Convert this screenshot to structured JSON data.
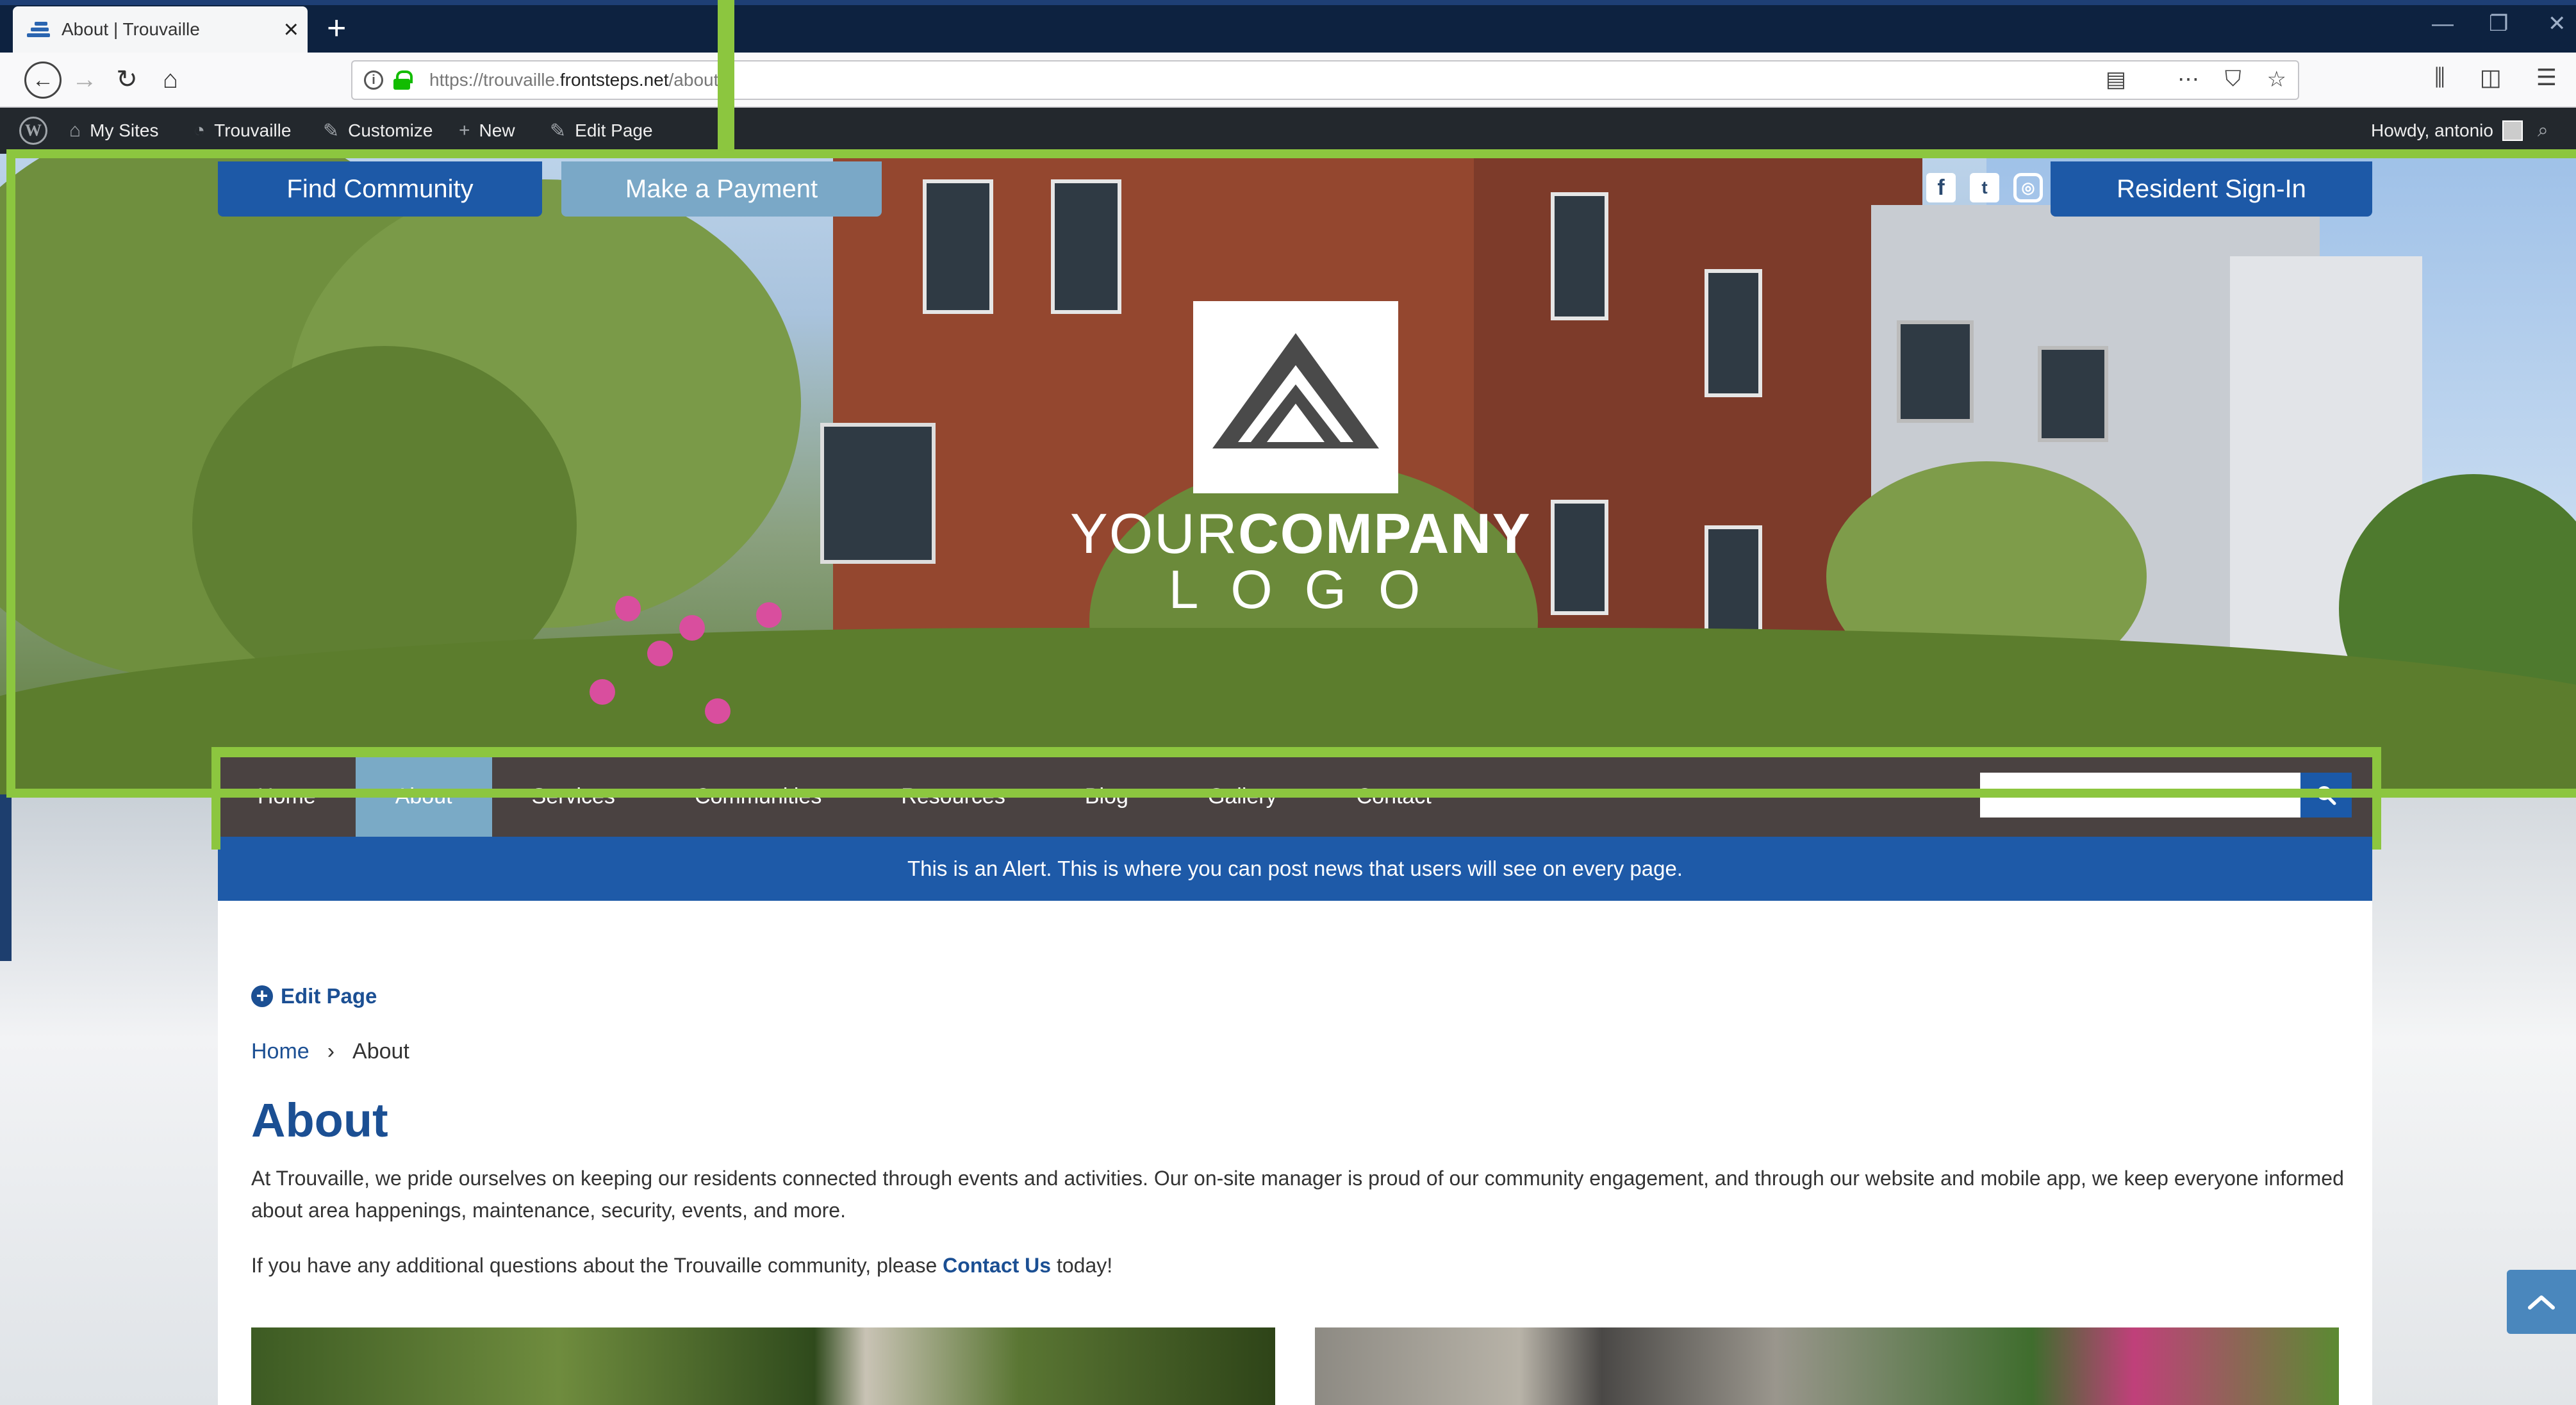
{
  "browser": {
    "tab_title": "About | Trouvaille",
    "tab_close": "×",
    "new_tab": "+",
    "url_prefix": "https://trouvaille.",
    "url_domain": "frontsteps.net",
    "url_path": "/about/",
    "window_min": "—",
    "window_restore": "❐",
    "window_close": "✕"
  },
  "wp_admin_bar": {
    "my_sites": "My Sites",
    "site_name": "Trouvaille",
    "customize": "Customize",
    "new": "New",
    "edit_page": "Edit Page",
    "howdy": "Howdy, antonio"
  },
  "header": {
    "find_community": "Find Community",
    "make_payment": "Make a Payment",
    "resident_sign_in": "Resident Sign-In",
    "logo_light": "YOUR",
    "logo_bold": "COMPANY",
    "logo_sub": "LOGO",
    "social": [
      "facebook-icon",
      "twitter-icon",
      "instagram-icon"
    ]
  },
  "nav": {
    "items": [
      "Home",
      "About",
      "Services",
      "Communities",
      "Resources",
      "Blog",
      "Gallery",
      "Contact"
    ],
    "active": "About",
    "search_placeholder": ""
  },
  "alert": {
    "text": "This is an Alert. This is where you can post news that users will see on every page."
  },
  "content": {
    "edit_page": "Edit Page",
    "breadcrumb_home": "Home",
    "breadcrumb_sep": "›",
    "breadcrumb_current": "About",
    "title": "About",
    "paragraph1": "At Trouvaille, we pride ourselves on keeping our residents connected through events and activities. Our on-site manager is proud of our community engagement, and through our website and mobile app, we keep everyone informed about area happenings, maintenance, security, events, and more.",
    "paragraph2_before": "If you have any additional questions about the Trouvaille community, please ",
    "paragraph2_link": "Contact Us",
    "paragraph2_after": " today!"
  },
  "colors": {
    "brand_blue": "#1e5aa8",
    "nav_bg": "#4a4241",
    "nav_active": "#7aaac6",
    "highlight_frame": "#8cc63f",
    "wp_bar": "#23282d"
  }
}
